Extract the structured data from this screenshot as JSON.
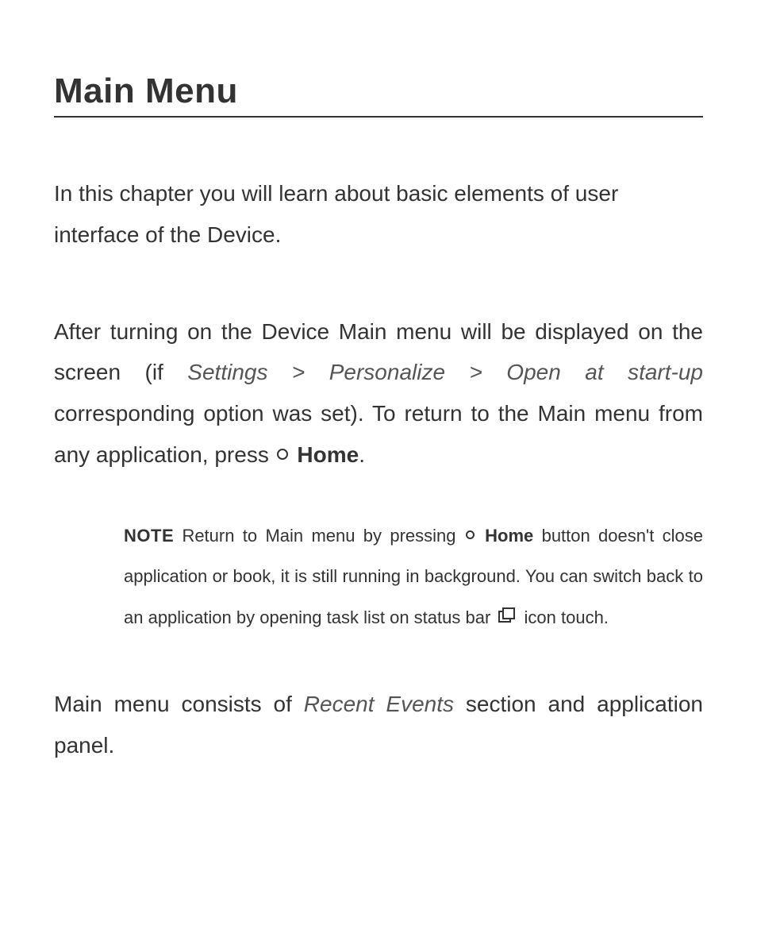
{
  "heading": "Main Menu",
  "intro": "In this chapter you will learn about basic elements of user interface of the Device.",
  "p2_part1": "After turning on the Device Main menu will be displayed on the screen (if ",
  "p2_italic": "Settings > Personalize > Open at start-up",
  "p2_part2": " corresponding option was set). To return to the Main menu from any application, press ",
  "p2_home": "Home",
  "p2_end": ".",
  "note_label": "NOTE",
  "note_part1": " Return to Main menu by pressing ",
  "note_home": "Home",
  "note_part2": " button doesn't close application or book, it is still running in background. You can switch back to an application by opening task list on status bar ",
  "note_part3": " icon touch.",
  "p3_part1": "Main menu consists of ",
  "p3_italic": "Recent Events",
  "p3_part2": " section and application panel."
}
